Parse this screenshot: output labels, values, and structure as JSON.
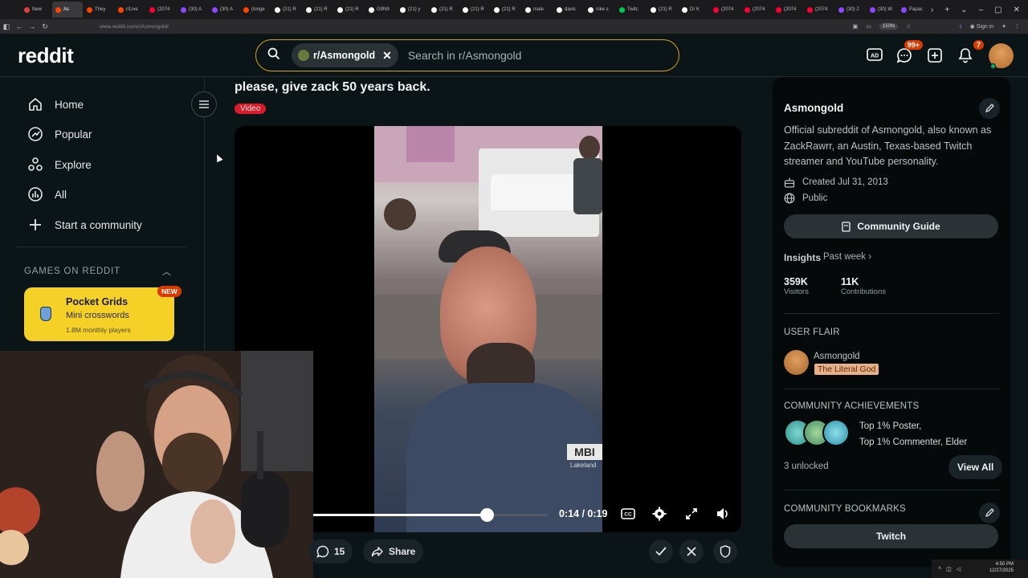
{
  "browser": {
    "tabs": [
      {
        "label": "New",
        "color": "#e04040"
      },
      {
        "label": "As",
        "color": "#ff4500",
        "active": true
      },
      {
        "label": "They",
        "color": "#ff4500"
      },
      {
        "label": "r/Live",
        "color": "#ff4500"
      },
      {
        "label": "(2074",
        "color": "#ff0033"
      },
      {
        "label": "(30) A",
        "color": "#9146ff"
      },
      {
        "label": "(30) A",
        "color": "#9146ff"
      },
      {
        "label": "(longe",
        "color": "#ff4500"
      },
      {
        "label": "(21) R",
        "color": "#ffffff"
      },
      {
        "label": "(21) R",
        "color": "#ffffff"
      },
      {
        "label": "(21) R",
        "color": "#ffffff"
      },
      {
        "label": "G9N9",
        "color": "#ffffff"
      },
      {
        "label": "(21) y",
        "color": "#ffffff"
      },
      {
        "label": "(21) R",
        "color": "#ffffff"
      },
      {
        "label": "(21) R",
        "color": "#ffffff"
      },
      {
        "label": "(21) R",
        "color": "#ffffff"
      },
      {
        "label": "male",
        "color": "#ffffff"
      },
      {
        "label": "davic",
        "color": "#ffffff"
      },
      {
        "label": "nike s",
        "color": "#ffffff"
      },
      {
        "label": "Twitc",
        "color": "#00c853"
      },
      {
        "label": "(21) R",
        "color": "#ffffff"
      },
      {
        "label": "Dr K",
        "color": "#ffffff"
      },
      {
        "label": "(2074",
        "color": "#ff0033"
      },
      {
        "label": "(2074",
        "color": "#ff0033"
      },
      {
        "label": "(2074",
        "color": "#ff0033"
      },
      {
        "label": "(2074",
        "color": "#ff0033"
      },
      {
        "label": "(30) 2",
        "color": "#9146ff"
      },
      {
        "label": "(30) W",
        "color": "#9146ff"
      },
      {
        "label": "Papac",
        "color": "#9146ff"
      }
    ],
    "url": "www.reddit.com/r/Asmongold/",
    "zoom": "150%",
    "signin": "Sign in"
  },
  "header": {
    "logo": "reddit",
    "search_chip": "r/Asmongold",
    "search_placeholder": "Search in r/Asmongold",
    "chat_badge": "99+",
    "notif_badge": "7"
  },
  "leftnav": {
    "items": [
      {
        "label": "Home"
      },
      {
        "label": "Popular"
      },
      {
        "label": "Explore"
      },
      {
        "label": "All"
      },
      {
        "label": "Start a community"
      }
    ],
    "games_title": "GAMES ON REDDIT",
    "game": {
      "badge": "NEW",
      "name": "Pocket Grids",
      "subtitle": "Mini crosswords",
      "players": "1.8M monthly players"
    }
  },
  "post": {
    "title": "please, give zack 50 years back.",
    "flair": "Video",
    "player": {
      "time": "0:14 / 0:19",
      "progress": 0.74,
      "shirt_text": "MBI",
      "shirt_sub": "Lakeland"
    },
    "comments": "15",
    "share": "Share"
  },
  "sidebar": {
    "name": "Asmongold",
    "description": "Official subreddit of Asmongold, also known as ZackRawrr, an Austin, Texas-based Twitch streamer and YouTube personality.",
    "created": "Created Jul 31, 2013",
    "visibility": "Public",
    "guide": "Community Guide",
    "insights_label": "Insights",
    "insights_range": "Past week",
    "stats": [
      {
        "value": "359K",
        "label": "Visitors"
      },
      {
        "value": "11K",
        "label": "Contributions"
      }
    ],
    "user_flair_title": "USER FLAIR",
    "flair_user": "Asmongold",
    "flair_tag": "The Literal God",
    "achievements_title": "COMMUNITY ACHIEVEMENTS",
    "achievements_line1": "Top 1% Poster,",
    "achievements_line2": "Top 1% Commenter, Elder",
    "achievements_unlocked": "3 unlocked",
    "view_all": "View All",
    "bookmarks_title": "COMMUNITY BOOKMARKS",
    "bookmark": "Twitch"
  },
  "taskbar": {
    "time": "4:50 PM",
    "date": "12/27/2025"
  }
}
